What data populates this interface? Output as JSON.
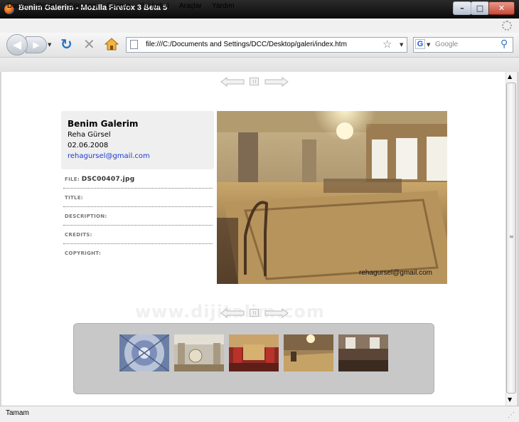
{
  "window": {
    "title": "Benim Galerim - Mozilla Firefox 3 Beta 5",
    "minimize": "–",
    "maximize": "□",
    "close": "✕"
  },
  "menu": [
    "Dosya",
    "Düzen",
    "Görünüm",
    "Geçmiş",
    "Yer İmleri",
    "Araçlar",
    "Yardım"
  ],
  "toolbar": {
    "url": "file:///C:/Documents and Settings/DCC/Desktop/galeri/index.htm",
    "search_placeholder": "Google",
    "search_engine_letter": "G"
  },
  "gallery": {
    "title": "Benim Galerim",
    "author": "Reha Gürsel",
    "date": "02.06.2008",
    "email": "rehagursel@gmail.com",
    "meta": [
      {
        "label": "FILE:",
        "value": "DSC00407.jpg"
      },
      {
        "label": "TITLE:",
        "value": ""
      },
      {
        "label": "DESCRIPTION:",
        "value": ""
      },
      {
        "label": "CREDITS:",
        "value": ""
      },
      {
        "label": "COPYRIGHT:",
        "value": ""
      }
    ],
    "photo_credit": "rehagursel@gmail.com",
    "watermark": "www.dijitalim.com",
    "thumbnails": [
      "dome-ceiling",
      "chandelier-hall",
      "red-throne-room",
      "carpet-hall",
      "dark-salon"
    ]
  },
  "status": {
    "text": "Tamam"
  },
  "icons": {
    "back": "back-arrow-icon",
    "forward": "forward-arrow-icon",
    "reload": "reload-icon",
    "stop": "stop-icon",
    "home": "home-icon",
    "bookmark": "star-icon",
    "search": "magnifier-icon"
  }
}
